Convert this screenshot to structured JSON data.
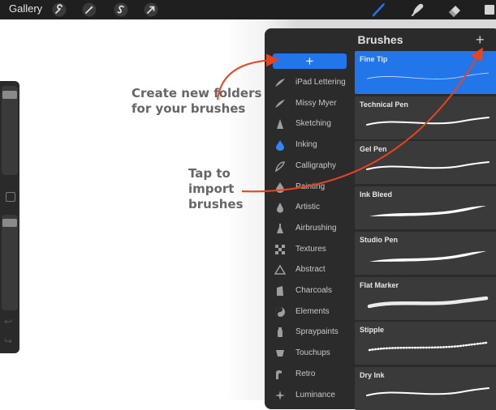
{
  "toolbar": {
    "gallery_label": "Gallery",
    "left_tools": [
      "wrench-icon",
      "magic-wand-icon",
      "selection-s-icon",
      "transform-arrow-icon"
    ],
    "right_tools": [
      "brush-icon",
      "smudge-icon",
      "eraser-icon",
      "layers-icon"
    ],
    "active_tool_color": "#2276ea"
  },
  "annotations": {
    "create_folders": "Create new folders\nfor your brushes",
    "tap_import": "Tap to\nimport\nbrushes",
    "arrow_color": "#e8441e"
  },
  "brushes_panel": {
    "title": "Brushes",
    "add_brush_icon": "plus-icon",
    "add_category_icon": "plus-icon",
    "categories": [
      {
        "label": "iPad Lettering",
        "icon": "lettering-stroke-icon",
        "active": false
      },
      {
        "label": "Missy Myer",
        "icon": "lettering-stroke-icon",
        "active": false
      },
      {
        "label": "Sketching",
        "icon": "pencil-tip-icon",
        "active": false
      },
      {
        "label": "Inking",
        "icon": "ink-drop-icon",
        "active": true
      },
      {
        "label": "Calligraphy",
        "icon": "calligraphy-icon",
        "active": false
      },
      {
        "label": "Painting",
        "icon": "paint-drop-icon",
        "active": false
      },
      {
        "label": "Artistic",
        "icon": "artistic-drop-icon",
        "active": false
      },
      {
        "label": "Airbrushing",
        "icon": "airbrush-icon",
        "active": false
      },
      {
        "label": "Textures",
        "icon": "texture-icon",
        "active": false
      },
      {
        "label": "Abstract",
        "icon": "triangle-icon",
        "active": false
      },
      {
        "label": "Charcoals",
        "icon": "charcoal-icon",
        "active": false
      },
      {
        "label": "Elements",
        "icon": "yin-yang-icon",
        "active": false
      },
      {
        "label": "Spraypaints",
        "icon": "spray-can-icon",
        "active": false
      },
      {
        "label": "Touchups",
        "icon": "touchup-icon",
        "active": false
      },
      {
        "label": "Retro",
        "icon": "retro-icon",
        "active": false
      },
      {
        "label": "Luminance",
        "icon": "sparkle-icon",
        "active": false
      }
    ],
    "brushes": [
      {
        "name": "Fine Tip",
        "selected": true,
        "stroke": "thin"
      },
      {
        "name": "Technical Pen",
        "selected": false,
        "stroke": "medium"
      },
      {
        "name": "Gel Pen",
        "selected": false,
        "stroke": "medium"
      },
      {
        "name": "Ink Bleed",
        "selected": false,
        "stroke": "taper"
      },
      {
        "name": "Studio Pen",
        "selected": false,
        "stroke": "taper"
      },
      {
        "name": "Flat Marker",
        "selected": false,
        "stroke": "thick"
      },
      {
        "name": "Stipple",
        "selected": false,
        "stroke": "dotted"
      },
      {
        "name": "Dry Ink",
        "selected": false,
        "stroke": "medium"
      }
    ]
  }
}
